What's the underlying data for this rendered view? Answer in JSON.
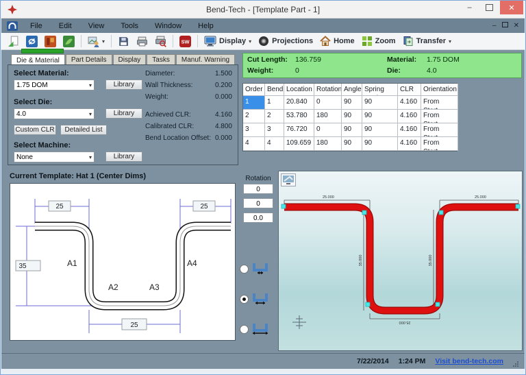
{
  "window": {
    "title": "Bend-Tech - [Template Part - 1]",
    "minimize_glyph": "–",
    "close_glyph": "✕"
  },
  "menu": {
    "items": [
      "File",
      "Edit",
      "View",
      "Tools",
      "Window",
      "Help"
    ]
  },
  "toolbar": {
    "display": "Display",
    "projections": "Projections",
    "home": "Home",
    "zoom": "Zoom",
    "transfer": "Transfer"
  },
  "tabs": {
    "items": [
      "Die & Material",
      "Part Details",
      "Display",
      "Tasks",
      "Manuf. Warning"
    ]
  },
  "material_panel": {
    "select_material_label": "Select Material:",
    "material_value": "1.75 DOM",
    "select_die_label": "Select Die:",
    "die_value": "4.0",
    "custom_clr": "Custom CLR",
    "detailed_list": "Detailed List",
    "select_machine_label": "Select Machine:",
    "machine_value": "None",
    "library": "Library",
    "props": [
      {
        "label": "Diameter:",
        "value": "1.500"
      },
      {
        "label": "Wall Thickness:",
        "value": "0.200"
      },
      {
        "label": "Weight:",
        "value": "0.000"
      },
      {
        "label": "Achieved CLR:",
        "value": "4.160"
      },
      {
        "label": "Calibrated CLR:",
        "value": "4.800"
      },
      {
        "label": "Bend Location Offset:",
        "value": "0.000"
      }
    ]
  },
  "summary": {
    "cut_length_label": "Cut Length:",
    "cut_length": "136.759",
    "weight_label": "Weight:",
    "weight": "0",
    "material_label": "Material:",
    "material": "1.75 DOM",
    "die_label": "Die:",
    "die": "4.0"
  },
  "bend_table": {
    "columns": [
      "Order",
      "Bend",
      "Location",
      "Rotation",
      "Angle",
      "Spring Angle",
      "CLR",
      "Orientation"
    ],
    "rows": [
      [
        "1",
        "1",
        "20.840",
        "0",
        "90",
        "90",
        "4.160",
        "From Start"
      ],
      [
        "2",
        "2",
        "53.780",
        "180",
        "90",
        "90",
        "4.160",
        "From Start"
      ],
      [
        "3",
        "3",
        "76.720",
        "0",
        "90",
        "90",
        "4.160",
        "From Start"
      ],
      [
        "4",
        "4",
        "109.659",
        "180",
        "90",
        "90",
        "4.160",
        "From Start"
      ]
    ]
  },
  "template_panel": {
    "header": "Current Template: Hat 1 (Center Dims)",
    "dims": {
      "top_left": "25",
      "top_right": "25",
      "left": "35",
      "bottom": "25"
    },
    "bend_labels": [
      "A1",
      "A2",
      "A3",
      "A4"
    ]
  },
  "rotation_panel": {
    "label": "Rotation",
    "inputs": [
      "0",
      "0",
      "0.0"
    ]
  },
  "viewport": {
    "dims": {
      "top_left": "25.000",
      "top_right": "25.000",
      "left_leg": "35.000",
      "right_leg": "35.000",
      "bottom": "25.000"
    }
  },
  "statusbar": {
    "date": "7/22/2014",
    "time": "1:24 PM",
    "link": "Visit bend-tech.com"
  },
  "colors": {
    "summary_green": "#8fe58b",
    "progress_green": "#2ba32b",
    "panel_slate": "#7d91a1",
    "selection_blue": "#3a8fe8",
    "tube_red": "#de1010",
    "link_blue": "#1d4ed0"
  }
}
